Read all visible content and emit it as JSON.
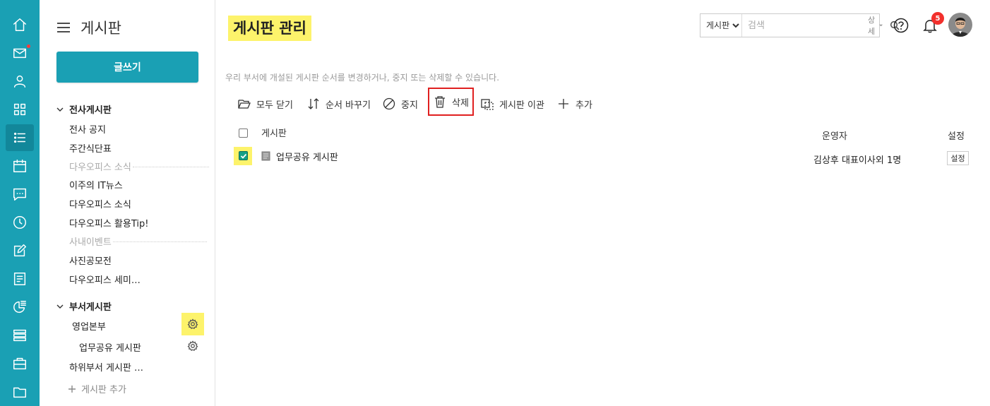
{
  "sidebar": {
    "title": "게시판",
    "write_label": "글쓰기",
    "groups": [
      {
        "label": "전사게시판"
      },
      {
        "label": "부서게시판"
      }
    ],
    "items": [
      {
        "label": "전사 공지"
      },
      {
        "label": "주간식단표"
      },
      {
        "label": "다우오피스 소식"
      },
      {
        "label": "이주의 IT뉴스"
      },
      {
        "label": "다우오피스 소식"
      },
      {
        "label": "다우오피스 활용Tip!"
      },
      {
        "label": "사내이벤트"
      },
      {
        "label": "사진공모전"
      },
      {
        "label": "다우오피스 세미…"
      },
      {
        "label": "영업본부"
      },
      {
        "label": "업무공유 게시판"
      },
      {
        "label": "하위부서 게시판 …"
      }
    ],
    "add_label": "게시판 추가"
  },
  "header": {
    "title": "게시판 관리",
    "search_scope": "게시판",
    "search_placeholder": "검색",
    "search_detail": "상세",
    "notification_count": "5"
  },
  "main": {
    "description": "우리 부서에 개설된 게시판 순서를 변경하거나, 중지 또는 삭제할 수 있습니다.",
    "toolbar": {
      "close_all": "모두 닫기",
      "reorder": "순서 바꾸기",
      "stop": "중지",
      "delete": "삭제",
      "transfer": "게시판 이관",
      "add": "추가"
    },
    "table": {
      "headers": {
        "board": "게시판",
        "operator": "운영자",
        "settings": "설정"
      },
      "rows": [
        {
          "name": "업무공유 게시판",
          "operator": "김상후 대표이사외 1명",
          "settings": "설정",
          "checked": true
        }
      ]
    }
  },
  "colors": {
    "accent": "#1aa0b4",
    "highlight": "#fdf36b",
    "danger": "#e02020"
  }
}
